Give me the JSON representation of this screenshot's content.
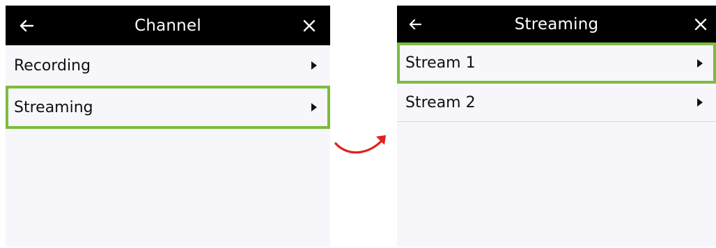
{
  "left_panel": {
    "title": "Channel",
    "back_icon": "arrow-left-icon",
    "close_icon": "close-icon",
    "items": [
      {
        "label": "Recording",
        "selected": false
      },
      {
        "label": "Streaming",
        "selected": true
      }
    ]
  },
  "right_panel": {
    "title": "Streaming",
    "back_icon": "arrow-left-icon",
    "close_icon": "close-icon",
    "items": [
      {
        "label": "Stream 1",
        "selected": true
      },
      {
        "label": "Stream 2",
        "selected": false
      }
    ]
  },
  "colors": {
    "header_bg": "#000000",
    "panel_bg": "#f6f6fb",
    "highlight": "#7dbb3f",
    "transition_arrow": "#e0211a"
  }
}
